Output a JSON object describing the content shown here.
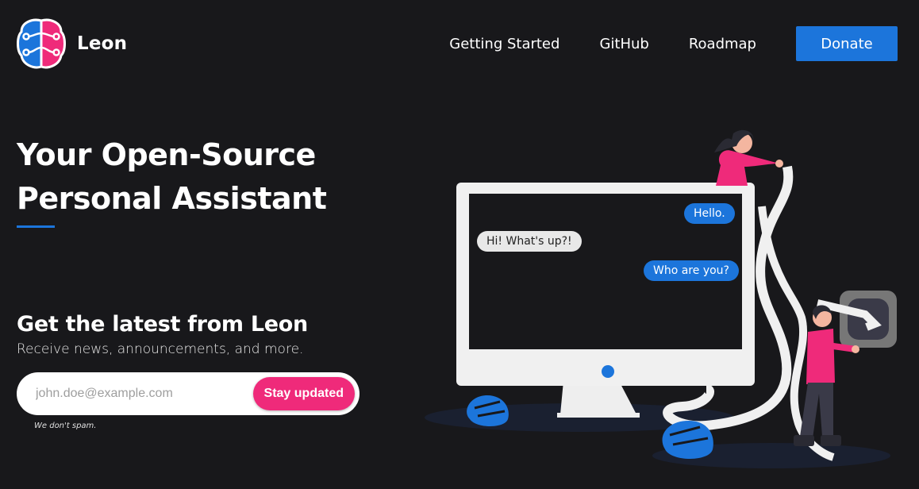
{
  "brand": {
    "name": "Leon"
  },
  "nav": {
    "items": [
      {
        "label": "Getting Started"
      },
      {
        "label": "GitHub"
      },
      {
        "label": "Roadmap"
      }
    ],
    "donate_label": "Donate"
  },
  "hero": {
    "title_line1": "Your Open-Source",
    "title_line2": "Personal Assistant"
  },
  "newsletter": {
    "title": "Get the latest from Leon",
    "subtitle": "Receive news, announcements, and more.",
    "email_placeholder": "john.doe@example.com",
    "button_label": "Stay updated",
    "note": "We don't spam."
  },
  "chat": {
    "messages": [
      {
        "from": "leon",
        "text": "Hello."
      },
      {
        "from": "user",
        "text": "Hi! What's up?!"
      },
      {
        "from": "leon",
        "text": "Who are you?"
      }
    ]
  },
  "colors": {
    "background": "#18181b",
    "accent_blue": "#1c75db",
    "accent_pink": "#ef2a7a"
  }
}
